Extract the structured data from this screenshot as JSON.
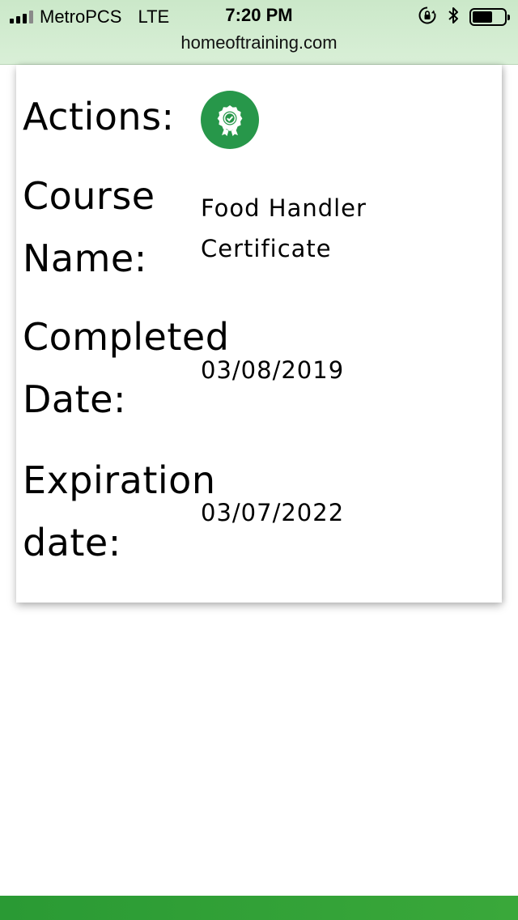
{
  "status_bar": {
    "carrier": "MetroPCS",
    "network": "LTE",
    "time": "7:20 PM",
    "url": "homeoftraining.com",
    "icons": [
      "signal-icon",
      "orientation-lock-icon",
      "bluetooth-icon",
      "battery-icon"
    ]
  },
  "card": {
    "actions_label": "Actions:",
    "action_icon": "certificate-badge-icon",
    "action_color": "#27974a",
    "course_label_line1": "Course",
    "course_label_line2": "Name:",
    "course_value_line1": "Food Handler",
    "course_value_line2": "Certificate",
    "completed_label_line1": "Completed",
    "completed_label_line2": "Date:",
    "completed_value": "03/08/2019",
    "expiration_label_line1": "Expiration",
    "expiration_label_line2": "date:",
    "expiration_value": "03/07/2022"
  },
  "colors": {
    "status_bar_bg": "#d9efd7",
    "bottom_bar": "#2a9a34"
  }
}
